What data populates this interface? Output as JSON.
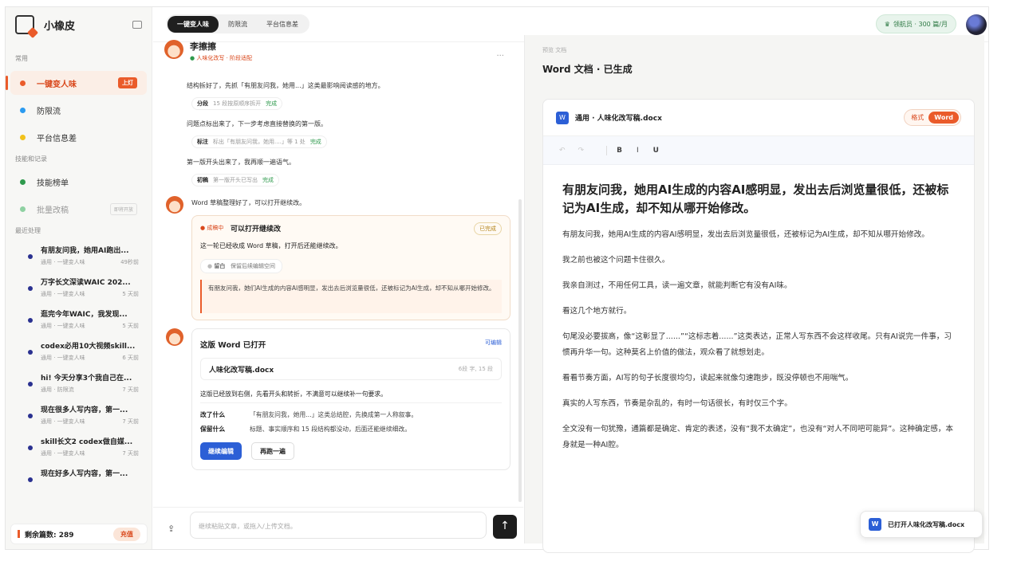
{
  "app": {
    "name": "小橡皮"
  },
  "sidebar": {
    "sec1": "常用",
    "items": [
      {
        "label": "一键变人味",
        "tag": "上灯",
        "color": "#ea5b2a"
      },
      {
        "label": "防限流",
        "color": "#2b9bf0"
      },
      {
        "label": "平台信息差",
        "color": "#f2c21b"
      }
    ],
    "sec2": "技能和记录",
    "items2": [
      {
        "label": "技能榜单",
        "color": "#2f9a4d"
      },
      {
        "label": "批量改稿",
        "tag": "即将开放",
        "color": "#8fd1a2"
      }
    ],
    "sec3": "最近处理",
    "recent": [
      {
        "title": "有朋友问我，她用AI跑出...",
        "meta": "通用 · 一键变人味",
        "time": "49秒前"
      },
      {
        "title": "万字长文深读WAIC 202...",
        "meta": "通用 · 一键变人味",
        "time": "5 天前"
      },
      {
        "title": "逛完今年WAIC，我发现...",
        "meta": "通用 · 一键变人味",
        "time": "5 天前"
      },
      {
        "title": "codex必用10大视频skill...",
        "meta": "通用 · 一键变人味",
        "time": "6 天前"
      },
      {
        "title": "hi! 今天分享3个我自己在...",
        "meta": "通用 · 防限流",
        "time": "7 天前"
      },
      {
        "title": "现在很多人写内容，第一...",
        "meta": "通用 · 一键变人味",
        "time": "7 天前"
      },
      {
        "title": "skill长文2 codex做自媒...",
        "meta": "通用 · 一键变人味",
        "time": "7 天前"
      },
      {
        "title": "现在好多人写内容，第一...",
        "meta": "",
        "time": ""
      }
    ],
    "remaining": "剩余篇数: 289",
    "recharge": "充值"
  },
  "header": {
    "tabs": [
      "一键变人味",
      "防限流",
      "平台信息差"
    ],
    "member": "领航员 · 300 篇/月"
  },
  "chat": {
    "name": "李擦擦",
    "status": "人味化改写 · 阶段适配",
    "more": "...",
    "m1": "结构拆好了，先抓「有朋友问我，她用...」这类最影响阅读感的地方。",
    "s1": {
      "k": "分段",
      "v": "15 段按原顺序拆开",
      "d": "完成"
    },
    "m2": "问题点标出来了，下一步考虑直接替换的第一版。",
    "s2": {
      "k": "标注",
      "v": "标出「有朋友问我，她用....」等 1 处",
      "d": "完成"
    },
    "m3": "第一版开头出来了，我再顺一遍语气。",
    "s3": {
      "k": "初稿",
      "v": "第一版开头已写出",
      "d": "完成"
    },
    "m4": "Word 草稿整理好了，可以打开继续改。",
    "card1": {
      "state": "成稿中",
      "title": "可以打开继续改",
      "badge": "已完成",
      "desc": "这一轮已经收成 Word 草稿，打开后还能继续改。",
      "chip": "留白",
      "chip2": "保留后续编辑空间",
      "quote": "有朋友问我，她们AI生成的内容AI感明显，发出去后浏览量很低，还被标记为AI生成，却不知从哪开始修改。"
    },
    "card2": {
      "title": "这版 Word 已打开",
      "link": "可编辑",
      "file": "人味化改写稿.docx",
      "fileMeta": "6段 字, 15 段",
      "desc": "这版已经放到右侧，先看开头和转折，不满意可以继续补一句要求。",
      "k1": "改了什么",
      "v1": "「有朋友问我，她用...」这类总结腔，先换成第一人称叙事。",
      "k2": "保留什么",
      "v2": "标题、事实顺序和 15 段结构都没动，后面还能继续细改。",
      "btn1": "继续编辑",
      "btn2": "再跑一遍"
    },
    "placeholder": "继续粘贴文章，或拖入/上传文档。",
    "send": "↑",
    "upload": "⇪"
  },
  "doc": {
    "kicker": "预览 文档",
    "title": "Word 文档 · 已生成",
    "filename": "通用 · 人味化改写稿.docx",
    "fmt": "格式",
    "fmtWord": "Word",
    "toolbar": {
      "undo": "↶",
      "redo": "↷",
      "b": "B",
      "i": "I",
      "u": "U"
    },
    "h1": "有朋友问我，她用AI生成的内容AI感明显，发出去后浏览量很低，还被标记为AI生成，却不知从哪开始修改。",
    "paras": [
      "有朋友问我，她用AI生成的内容AI感明显，发出去后浏览量很低，还被标记为AI生成，却不知从哪开始修改。",
      "我之前也被这个问题卡住很久。",
      "我亲自测过，不用任何工具，读一遍文章，就能判断它有没有AI味。",
      "看这几个地方就行。",
      "句尾没必要拔高，像“这彰显了......”“这标志着......”这类表达，正常人写东西不会这样收尾。只有AI说完一件事，习惯再升华一句。这种莫名上价值的做法，观众看了就想划走。",
      "看看节奏方面，AI写的句子长度很均匀，读起来就像匀速跑步，既没停顿也不用喘气。",
      "真实的人写东西，节奏是杂乱的，有时一句话很长，有时仅三个字。",
      "全文没有一句犹豫，通篇都是确定、肯定的表述，没有“我不太确定”，也没有“对人不同吧可能异”。这种确定感，本身就是一种AI腔。"
    ],
    "toast": "已打开人味化改写稿.docx"
  }
}
